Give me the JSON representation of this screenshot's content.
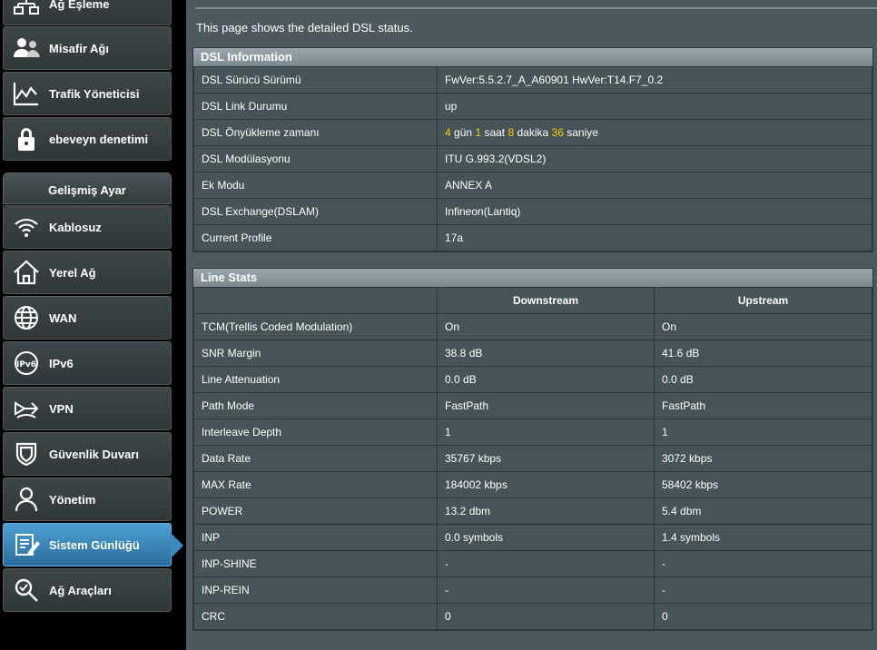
{
  "sidebar": {
    "items_top": [
      {
        "label": "Ağ Eşleme",
        "icon": "network-map-icon"
      },
      {
        "label": "Misafir Ağı",
        "icon": "guest-network-icon"
      },
      {
        "label": "Trafik Yöneticisi",
        "icon": "traffic-manager-icon"
      },
      {
        "label": "ebeveyn denetimi",
        "icon": "lock-icon"
      }
    ],
    "section_title": "Gelişmiş Ayar",
    "items": [
      {
        "label": "Kablosuz",
        "icon": "wifi-icon"
      },
      {
        "label": "Yerel Ağ",
        "icon": "home-icon"
      },
      {
        "label": "WAN",
        "icon": "globe-icon"
      },
      {
        "label": "IPv6",
        "icon": "ipv6-icon"
      },
      {
        "label": "VPN",
        "icon": "vpn-icon"
      },
      {
        "label": "Güvenlik Duvarı",
        "icon": "shield-icon"
      },
      {
        "label": "Yönetim",
        "icon": "admin-user-icon"
      },
      {
        "label": "Sistem Günlüğü",
        "icon": "system-log-icon",
        "active": true
      },
      {
        "label": "Ağ Araçları",
        "icon": "network-tools-icon"
      }
    ]
  },
  "main": {
    "description": "This page shows the detailed DSL status.",
    "dsl_info": {
      "title": "DSL Information",
      "rows": [
        {
          "label": "DSL Sürücü Sürümü",
          "value": "FwVer:5.5.2.7_A_A60901 HwVer:T14.F7_0.2"
        },
        {
          "label": "DSL Link Durumu",
          "value": "up"
        },
        {
          "label": "DSL Önyükleme zamanı",
          "uptime": {
            "days": "4",
            "days_unit": "gün",
            "hours": "1",
            "hours_unit": "saat",
            "minutes": "8",
            "minutes_unit": "dakika",
            "seconds": "36",
            "seconds_unit": "saniye"
          }
        },
        {
          "label": "DSL Modülasyonu",
          "value": "ITU G.993.2(VDSL2)"
        },
        {
          "label": "Ek Modu",
          "value": "ANNEX A"
        },
        {
          "label": "DSL Exchange(DSLAM)",
          "value": "Infineon(Lantiq)"
        },
        {
          "label": "Current Profile",
          "value": "17a"
        }
      ]
    },
    "line_stats": {
      "title": "Line Stats",
      "columns": [
        "Downstream",
        "Upstream"
      ],
      "rows": [
        {
          "label": "TCM(Trellis Coded Modulation)",
          "down": "On",
          "up": "On"
        },
        {
          "label": "SNR Margin",
          "down": "38.8 dB",
          "up": "41.6 dB"
        },
        {
          "label": "Line Attenuation",
          "down": "0.0 dB",
          "up": "0.0 dB"
        },
        {
          "label": "Path Mode",
          "down": "FastPath",
          "up": "FastPath"
        },
        {
          "label": "Interleave Depth",
          "down": "1",
          "up": "1"
        },
        {
          "label": "Data Rate",
          "down": "35767 kbps",
          "up": "3072 kbps"
        },
        {
          "label": "MAX Rate",
          "down": "184002 kbps",
          "up": "58402 kbps"
        },
        {
          "label": "POWER",
          "down": "13.2 dbm",
          "up": "5.4 dbm"
        },
        {
          "label": "INP",
          "down": "0.0 symbols",
          "up": "1.4 symbols"
        },
        {
          "label": "INP-SHINE",
          "down": "-",
          "up": "-"
        },
        {
          "label": "INP-REIN",
          "down": "-",
          "up": "-"
        },
        {
          "label": "CRC",
          "down": "0",
          "up": "0"
        }
      ]
    }
  },
  "colors": {
    "accent": "#ffcc00",
    "active_nav": "#3b8bc0",
    "panel": "#475457",
    "header": "#8a989d"
  }
}
